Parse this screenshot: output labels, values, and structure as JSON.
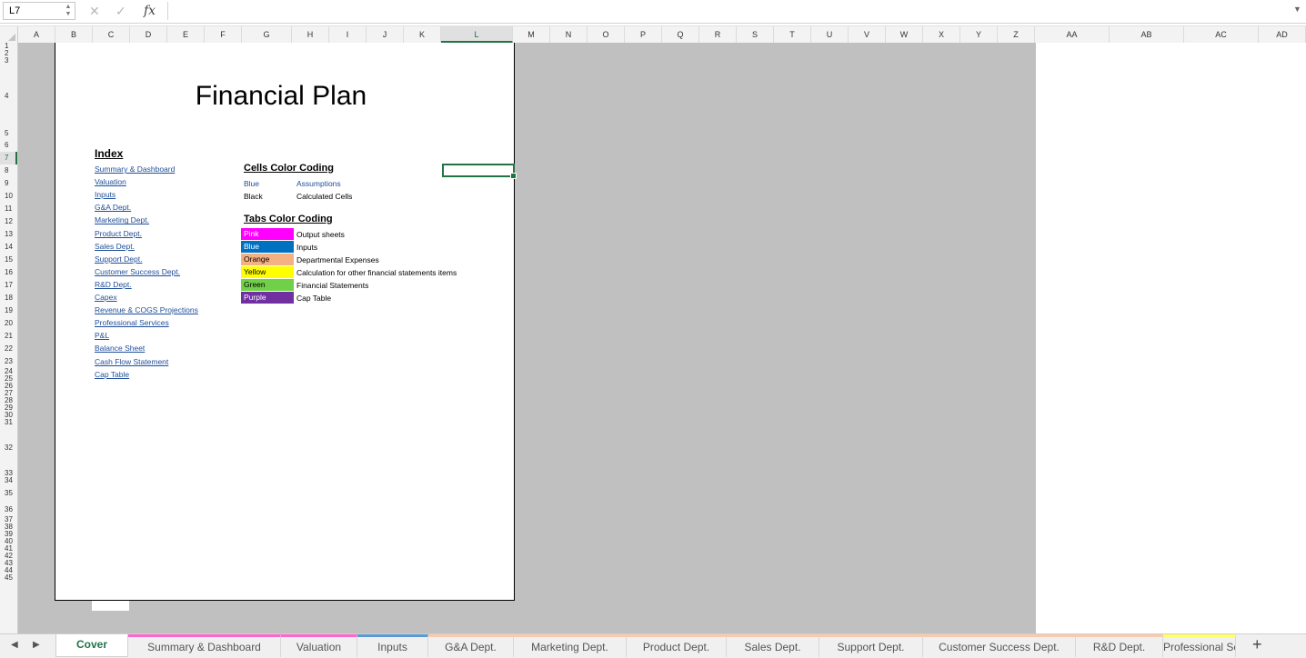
{
  "formula_bar": {
    "cell_ref": "L7",
    "formula": ""
  },
  "columns": [
    {
      "label": "A",
      "w": 41
    },
    {
      "label": "B",
      "w": 41
    },
    {
      "label": "C",
      "w": 41
    },
    {
      "label": "D",
      "w": 41
    },
    {
      "label": "E",
      "w": 41
    },
    {
      "label": "F",
      "w": 41
    },
    {
      "label": "G",
      "w": 55
    },
    {
      "label": "H",
      "w": 41
    },
    {
      "label": "I",
      "w": 41
    },
    {
      "label": "J",
      "w": 41
    },
    {
      "label": "K",
      "w": 41
    },
    {
      "label": "L",
      "w": 79
    },
    {
      "label": "M",
      "w": 41
    },
    {
      "label": "N",
      "w": 41
    },
    {
      "label": "O",
      "w": 41
    },
    {
      "label": "P",
      "w": 41
    },
    {
      "label": "Q",
      "w": 41
    },
    {
      "label": "R",
      "w": 41
    },
    {
      "label": "S",
      "w": 41
    },
    {
      "label": "T",
      "w": 41
    },
    {
      "label": "U",
      "w": 41
    },
    {
      "label": "V",
      "w": 41
    },
    {
      "label": "W",
      "w": 41
    },
    {
      "label": "X",
      "w": 41
    },
    {
      "label": "Y",
      "w": 41
    },
    {
      "label": "Z",
      "w": 41
    },
    {
      "label": "AA",
      "w": 82
    },
    {
      "label": "AB",
      "w": 82
    },
    {
      "label": "AC",
      "w": 82
    },
    {
      "label": "AD",
      "w": 82
    }
  ],
  "selected_column": "L",
  "rows": [
    {
      "n": "1",
      "h": 8
    },
    {
      "n": "2",
      "h": 8
    },
    {
      "n": "3",
      "h": 8
    },
    {
      "n": "4",
      "h": 70
    },
    {
      "n": "5",
      "h": 12
    },
    {
      "n": "6",
      "h": 14
    },
    {
      "n": "7",
      "h": 14
    },
    {
      "n": "8",
      "h": 14
    },
    {
      "n": "9",
      "h": 14
    },
    {
      "n": "10",
      "h": 14
    },
    {
      "n": "11",
      "h": 14
    },
    {
      "n": "12",
      "h": 14
    },
    {
      "n": "13",
      "h": 14
    },
    {
      "n": "14",
      "h": 14
    },
    {
      "n": "15",
      "h": 14
    },
    {
      "n": "16",
      "h": 14
    },
    {
      "n": "17",
      "h": 14
    },
    {
      "n": "18",
      "h": 14
    },
    {
      "n": "19",
      "h": 14
    },
    {
      "n": "20",
      "h": 14
    },
    {
      "n": "21",
      "h": 14
    },
    {
      "n": "22",
      "h": 14
    },
    {
      "n": "23",
      "h": 14
    },
    {
      "n": "24",
      "h": 8
    },
    {
      "n": "25",
      "h": 8
    },
    {
      "n": "26",
      "h": 8
    },
    {
      "n": "27",
      "h": 8
    },
    {
      "n": "28",
      "h": 8
    },
    {
      "n": "29",
      "h": 8
    },
    {
      "n": "30",
      "h": 8
    },
    {
      "n": "31",
      "h": 8
    },
    {
      "n": "32",
      "h": 48
    },
    {
      "n": "33",
      "h": 8
    },
    {
      "n": "34",
      "h": 8
    },
    {
      "n": "35",
      "h": 20
    },
    {
      "n": "36",
      "h": 15
    },
    {
      "n": "37",
      "h": 8
    },
    {
      "n": "38",
      "h": 8
    },
    {
      "n": "39",
      "h": 8
    },
    {
      "n": "40",
      "h": 8
    },
    {
      "n": "41",
      "h": 8
    },
    {
      "n": "42",
      "h": 8
    },
    {
      "n": "43",
      "h": 8
    },
    {
      "n": "44",
      "h": 8
    },
    {
      "n": "45",
      "h": 8
    }
  ],
  "selected_row": "7",
  "cover": {
    "title": "Financial Plan",
    "index_heading": "Index",
    "index_links": [
      "Summary & Dashboard",
      "Valuation",
      "Inputs",
      "G&A Dept.",
      "Marketing Dept.",
      "Product Dept.",
      "Sales Dept.",
      "Support Dept.",
      "Customer Success Dept.",
      "R&D Dept.",
      "Capex",
      "Revenue & COGS Projections",
      "Professional Services",
      "P&L",
      "Balance Sheet",
      "Cash Flow Statement",
      "Cap Table"
    ],
    "cells_heading": "Cells Color Coding ",
    "cells_legend": [
      {
        "label": "Blue",
        "desc": "Assumptions",
        "color": "#1f4e9a"
      },
      {
        "label": "Black",
        "desc": "Calculated Cells",
        "color": "#000000"
      }
    ],
    "tabs_heading": "Tabs Color Coding",
    "tabs_legend": [
      {
        "label": "Pink",
        "desc": "Output sheets",
        "bg": "#ff00ff",
        "fg": "#ffffff"
      },
      {
        "label": "Blue",
        "desc": "Inputs",
        "bg": "#0070c0",
        "fg": "#ffffff"
      },
      {
        "label": "Orange",
        "desc": "Departmental Expenses",
        "bg": "#f4b183",
        "fg": "#000000"
      },
      {
        "label": "Yellow",
        "desc": "Calculation for other financial statements items",
        "bg": "#ffff00",
        "fg": "#000000"
      },
      {
        "label": "Green",
        "desc": "Financial Statements",
        "bg": "#70d048",
        "fg": "#000000"
      },
      {
        "label": "Purple",
        "desc": "Cap Table",
        "bg": "#7030a0",
        "fg": "#ffffff"
      }
    ]
  },
  "sheet_tabs": [
    {
      "label": "Cover",
      "w": 80,
      "accent": "#ffffff",
      "active": true
    },
    {
      "label": "Summary & Dashboard",
      "w": 168,
      "accent": "#ff66cc"
    },
    {
      "label": "Valuation",
      "w": 84,
      "accent": "#ff66cc"
    },
    {
      "label": "Inputs",
      "w": 78,
      "accent": "#5b9bd5"
    },
    {
      "label": "G&A Dept.",
      "w": 94,
      "accent": "#f8cbad"
    },
    {
      "label": "Marketing Dept.",
      "w": 124,
      "accent": "#f8cbad"
    },
    {
      "label": "Product Dept.",
      "w": 110,
      "accent": "#f8cbad"
    },
    {
      "label": "Sales Dept.",
      "w": 102,
      "accent": "#f8cbad"
    },
    {
      "label": "Support Dept.",
      "w": 114,
      "accent": "#f8cbad"
    },
    {
      "label": "Customer Success Dept.",
      "w": 168,
      "accent": "#f8cbad"
    },
    {
      "label": "R&D Dept.",
      "w": 96,
      "accent": "#f8cbad"
    },
    {
      "label": "Professional Services",
      "w": 80,
      "accent": "#ffff66"
    }
  ]
}
